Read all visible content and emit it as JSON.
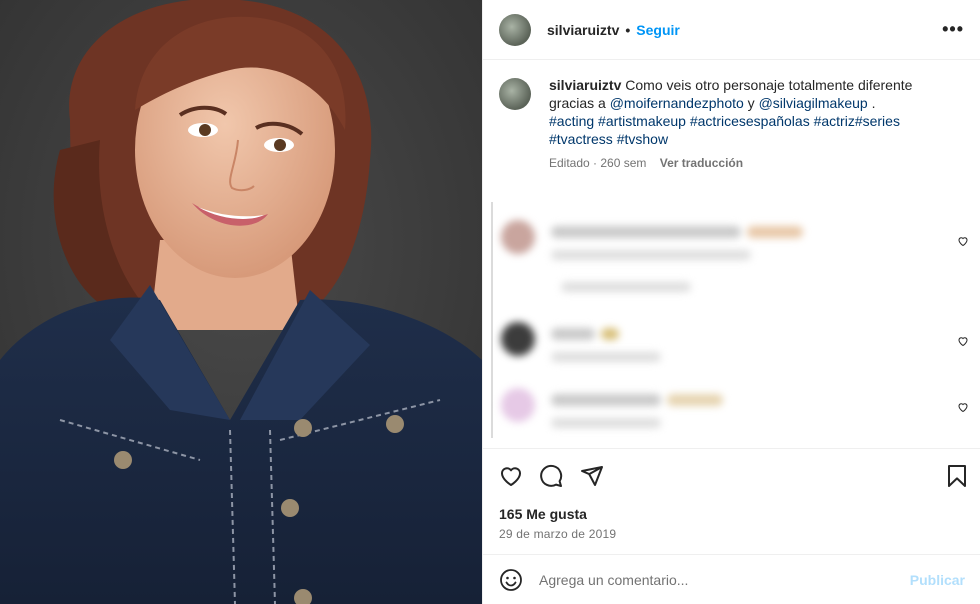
{
  "post": {
    "username": "silviaruiztv",
    "separator": "•",
    "follow_label": "Seguir",
    "more_label": "•••"
  },
  "caption": {
    "username": "silviaruiztv",
    "text_1": "Como veis otro personaje totalmente diferente",
    "text_2": "gracias a",
    "mention_1": "@moifernandezphoto",
    "text_3": "y",
    "mention_2": "@silviagilmakeup",
    "text_4": ".",
    "hashtags_line1": "#acting #artistmakeup #actricesespañolas #actriz#series",
    "hashtags_line2": "#tvactress #tvshow",
    "edited": "Editado · 260 sem",
    "translate_label": "Ver traducción"
  },
  "engagement": {
    "likes": "165 Me gusta",
    "date": "29 de marzo de 2019"
  },
  "comment_box": {
    "placeholder": "Agrega un comentario...",
    "publish_label": "Publicar"
  },
  "icons": {
    "like": "heart-icon",
    "comment": "comment-icon",
    "share": "paper-plane-icon",
    "save": "bookmark-icon",
    "emoji": "emoji-icon",
    "more": "more-horizontal-icon"
  },
  "colors": {
    "accent": "#0095f6",
    "link": "#00376b",
    "muted": "#737373",
    "publish_disabled": "#b2dffc"
  }
}
